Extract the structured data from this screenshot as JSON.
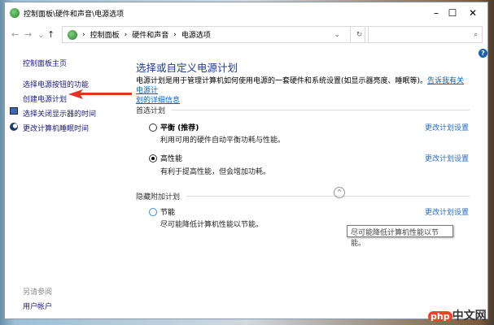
{
  "window": {
    "title": "控制面板\\硬件和声音\\电源选项",
    "minimize": "–",
    "maximize": "☐",
    "close": "✕"
  },
  "nav": {
    "back": "←",
    "forward": "→",
    "recent": "⌄",
    "up": "↑",
    "breadcrumb": [
      "控制面板",
      "硬件和声音",
      "电源选项"
    ],
    "separator": "›",
    "dropdown": "⌄",
    "refresh": "↻",
    "search_icon": "⌕",
    "search_placeholder": ""
  },
  "sidebar": {
    "home": "控制面板主页",
    "items": [
      "选择电源按钮的功能",
      "创建电源计划",
      "选择关闭显示器的时间",
      "更改计算机睡眠时间"
    ],
    "see_also": "另请参阅",
    "user_accounts": "用户帐户"
  },
  "main": {
    "title": "选择或自定义电源计划",
    "description": "电源计划是用于管理计算机如何使用电源的一套硬件和系统设置(如显示器亮度、睡眠等)。",
    "link1": "告诉我有关电源计",
    "link2": "划的详细信息",
    "preferred_group": "首选计划",
    "hidden_group": "隐藏附加计划",
    "plans": [
      {
        "name": "平衡 (推荐)",
        "desc": "利用可用的硬件自动平衡功耗与性能。",
        "selected": false,
        "change": "更改计划设置"
      },
      {
        "name": "高性能",
        "desc": "有利于提高性能，但会增加功耗。",
        "selected": true,
        "change": "更改计划设置"
      },
      {
        "name": "节能",
        "desc": "尽可能降低计算机性能以节能。",
        "selected": false,
        "change": "更改计划设置"
      }
    ],
    "tooltip": "尽可能降低计算机性能以节能。",
    "help": "?",
    "collapse": "^"
  },
  "watermark": "php中文网"
}
